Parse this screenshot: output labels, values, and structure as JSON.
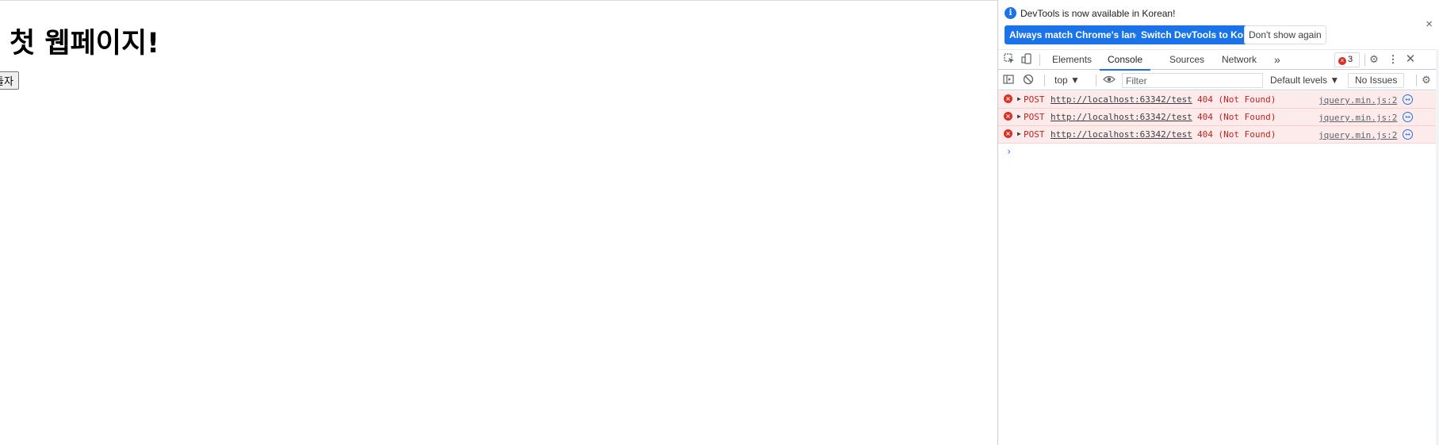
{
  "page": {
    "heading": "첫 웹페이지!",
    "button_label": "들자"
  },
  "devtools": {
    "infobar": {
      "icon": "info-icon",
      "message": "DevTools is now available in Korean!",
      "btn_match": "Always match Chrome's language",
      "btn_switch": "Switch DevTools to Korean",
      "btn_dismiss": "Don't show again",
      "close": "×"
    },
    "tabs": [
      "Elements",
      "Console",
      "Sources",
      "Network"
    ],
    "active_tab": "Console",
    "more_tabs": "»",
    "error_count": "3",
    "console_toolbar": {
      "context": "top ▼",
      "filter_placeholder": "Filter",
      "levels": "Default levels ▼",
      "issues": "No Issues"
    },
    "messages": [
      {
        "method": "POST",
        "url": "http://localhost:63342/test",
        "status": "404 (Not Found)",
        "source": "jquery.min.js:2"
      },
      {
        "method": "POST",
        "url": "http://localhost:63342/test",
        "status": "404 (Not Found)",
        "source": "jquery.min.js:2"
      },
      {
        "method": "POST",
        "url": "http://localhost:63342/test",
        "status": "404 (Not Found)",
        "source": "jquery.min.js:2"
      }
    ],
    "prompt": "›",
    "colors": {
      "accent": "#1a73e8",
      "error": "#d93025",
      "error_bg": "#fdebeb"
    }
  }
}
